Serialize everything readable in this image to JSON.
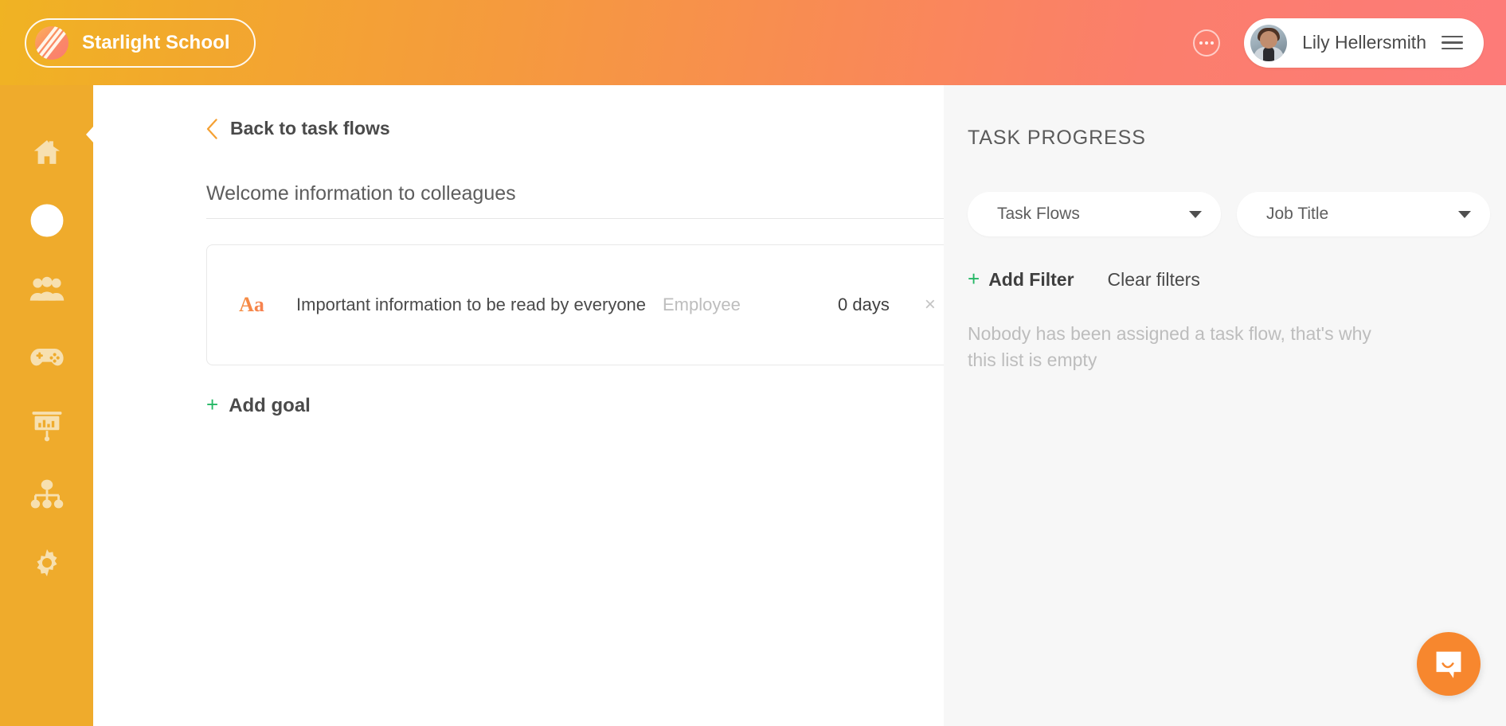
{
  "header": {
    "logo_text": "Starlight School",
    "logo_icon": "stripes-badge-icon",
    "more_icon": "ellipsis-icon",
    "user_name": "Lily Hellersmith",
    "avatar_icon": "user-avatar",
    "menu_icon": "hamburger-menu-icon"
  },
  "sidebar": {
    "items": [
      {
        "icon": "home-icon",
        "name": "home",
        "active": false
      },
      {
        "icon": "arrow-right-circle-icon",
        "name": "task-flows",
        "active": true
      },
      {
        "icon": "people-icon",
        "name": "people",
        "active": false
      },
      {
        "icon": "game-controller-icon",
        "name": "engagement",
        "active": false
      },
      {
        "icon": "presentation-chart-icon",
        "name": "reports",
        "active": false
      },
      {
        "icon": "org-chart-icon",
        "name": "org-chart",
        "active": false
      },
      {
        "icon": "gear-icon",
        "name": "settings",
        "active": false
      }
    ]
  },
  "main": {
    "back_label": "Back to task flows",
    "back_icon": "chevron-left-icon",
    "flow_title": "Welcome information to colleagues",
    "goal": {
      "type_icon_text": "Aa",
      "name": "Important information to be read by everyone",
      "assignee": "Employee",
      "days": "0 days",
      "remove_icon": "close-icon",
      "remove_glyph": "×"
    },
    "add_goal_label": "Add goal",
    "add_goal_plus": "+"
  },
  "right_panel": {
    "heading": "TASK PROGRESS",
    "filters": [
      {
        "label": "Task Flows",
        "name": "task-flows-select"
      },
      {
        "label": "Job Title",
        "name": "job-title-select"
      }
    ],
    "add_filter_label": "Add Filter",
    "add_filter_plus": "+",
    "clear_filters_label": "Clear filters",
    "empty_message": "Nobody has been assigned a task flow, that's why this list is empty"
  },
  "chat": {
    "icon": "chat-bubble-icon"
  },
  "colors": {
    "brand_amber": "#efab2c",
    "brand_coral": "#fd7b79",
    "accent_green": "#25b765",
    "panel_bg": "#f7f7f7",
    "chat_orange": "#f7872e"
  }
}
